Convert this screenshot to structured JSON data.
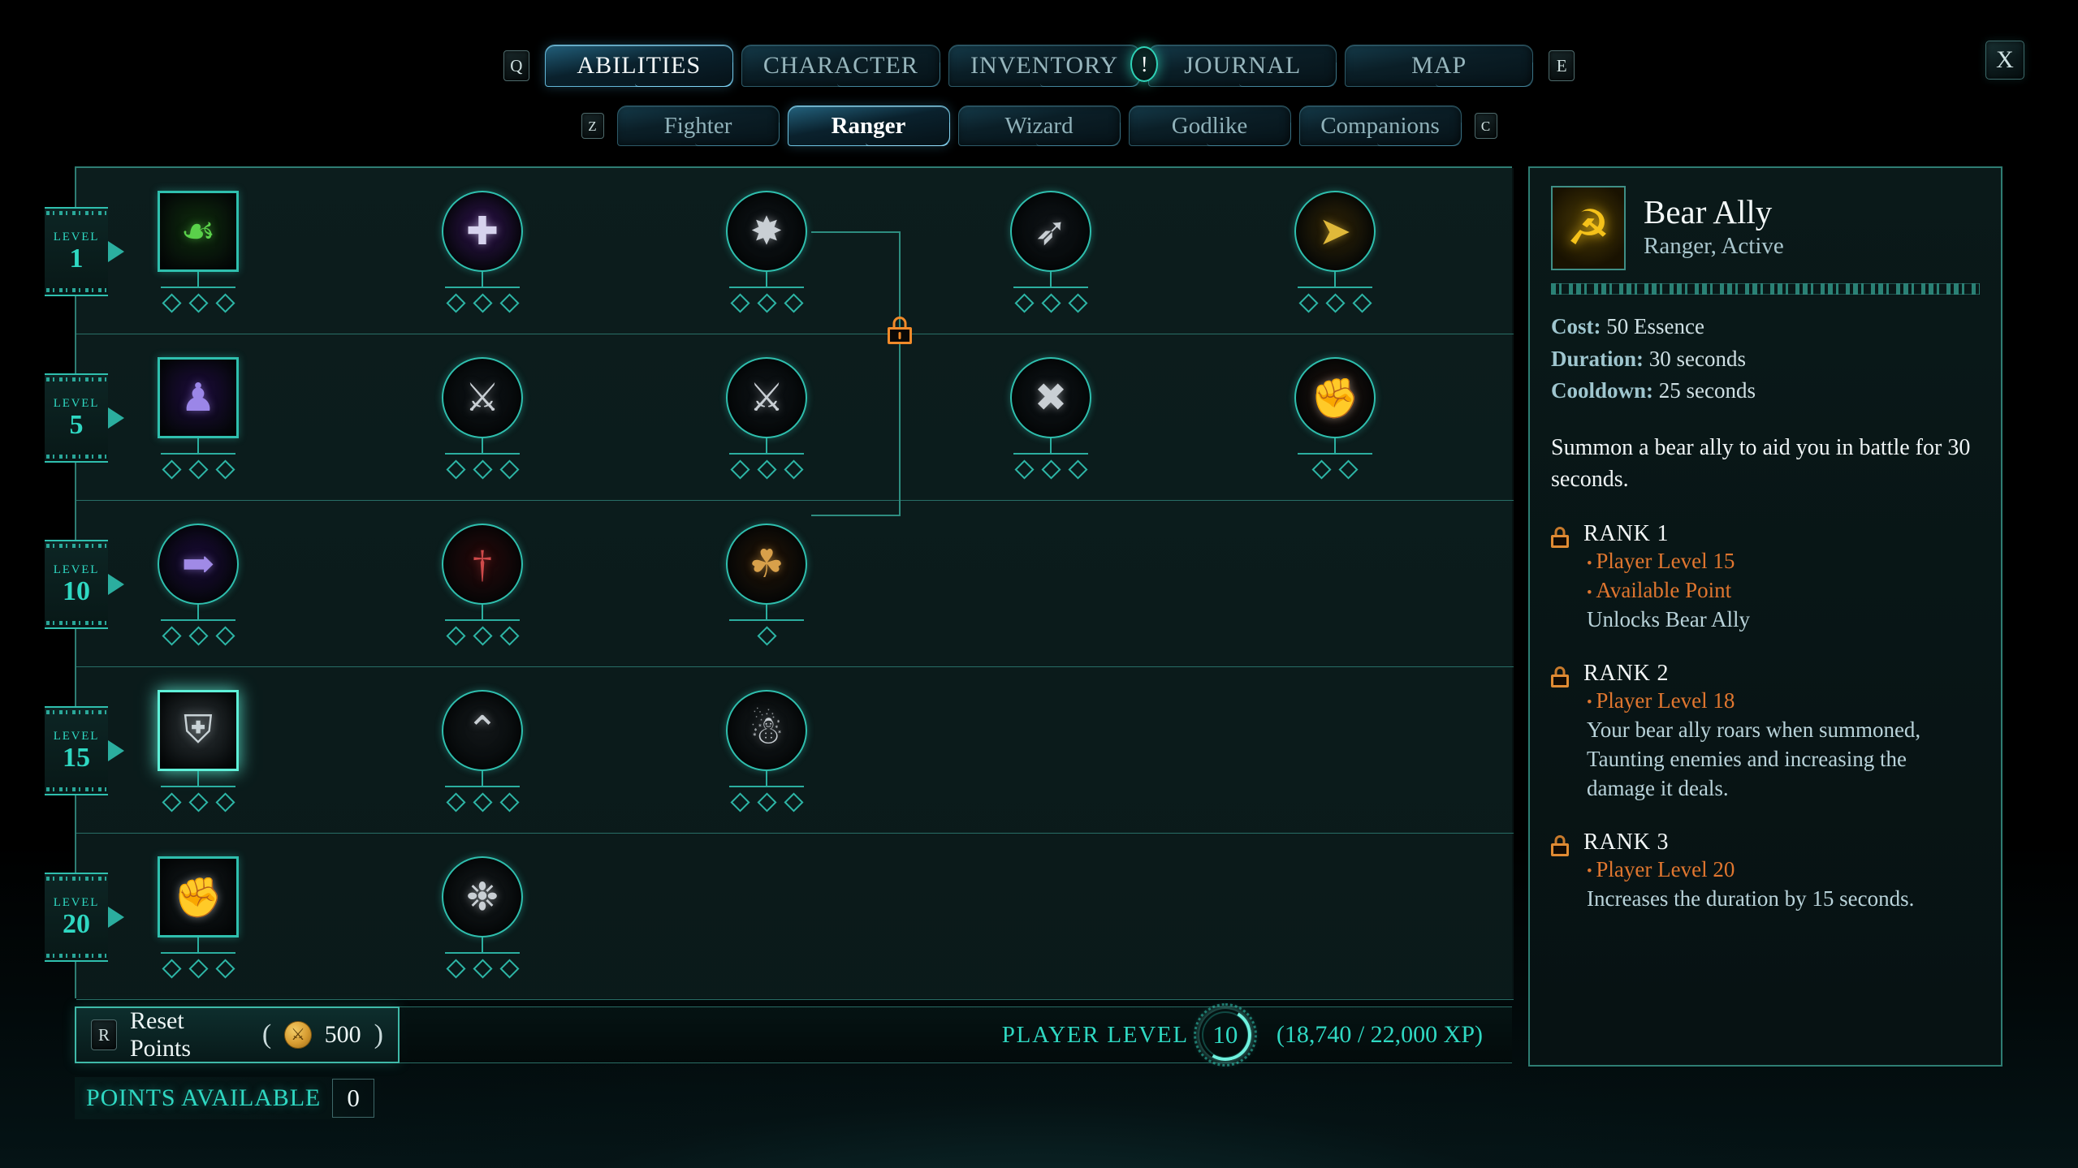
{
  "nav": {
    "left_key": "Q",
    "right_key": "E",
    "close_label": "X",
    "tabs": [
      {
        "label": "ABILITIES",
        "active": true,
        "badge": null
      },
      {
        "label": "CHARACTER",
        "active": false,
        "badge": null
      },
      {
        "label": "INVENTORY",
        "active": false,
        "badge": null
      },
      {
        "label": "JOURNAL",
        "active": false,
        "badge": "!"
      },
      {
        "label": "MAP",
        "active": false,
        "badge": null
      }
    ]
  },
  "subnav": {
    "left_key": "Z",
    "right_key": "C",
    "tabs": [
      {
        "label": "Fighter",
        "active": false
      },
      {
        "label": "Ranger",
        "active": true
      },
      {
        "label": "Wizard",
        "active": false
      },
      {
        "label": "Godlike",
        "active": false
      },
      {
        "label": "Companions",
        "active": false
      }
    ]
  },
  "tree": {
    "level_word": "LEVEL",
    "rows": [
      {
        "level": "1",
        "nodes": [
          {
            "name": "thorns-node",
            "shape": "square",
            "icon": "☙",
            "color": "#5ad14a",
            "bg": "#0e2a0c",
            "pips": 3,
            "locked": false,
            "selected": false
          },
          {
            "name": "potion-buff-node",
            "shape": "circle",
            "icon": "✚",
            "color": "#d7d3ee",
            "bg": "#2a1046",
            "pips": 3,
            "locked": false,
            "selected": false
          },
          {
            "name": "arrow-burst-node",
            "shape": "circle",
            "icon": "✸",
            "color": "#c9cfd4",
            "bg": "#0d1114",
            "pips": 3,
            "locked": false,
            "selected": false
          },
          {
            "name": "bow-shot-node",
            "shape": "circle",
            "icon": "➶",
            "color": "#c9cfd4",
            "bg": "#0d1114",
            "pips": 3,
            "locked": false,
            "selected": false
          },
          {
            "name": "volley-node",
            "shape": "circle",
            "icon": "➤",
            "color": "#e0b93a",
            "bg": "#2b2005",
            "pips": 3,
            "locked": false,
            "selected": false
          }
        ]
      },
      {
        "level": "5",
        "nodes": [
          {
            "name": "evasion-node",
            "shape": "square",
            "icon": "♟",
            "color": "#9b86e8",
            "bg": "#1c0b3a",
            "pips": 3,
            "locked": false,
            "selected": false
          },
          {
            "name": "piercing-shot-node",
            "shape": "circle",
            "icon": "⚔",
            "color": "#c9cfd4",
            "bg": "#0d1114",
            "pips": 3,
            "locked": false,
            "selected": false
          },
          {
            "name": "weapon-swap-node",
            "shape": "circle",
            "icon": "⚔",
            "color": "#c9cfd4",
            "bg": "#0d1114",
            "pips": 3,
            "locked": false,
            "selected": false
          },
          {
            "name": "crossed-blades-node",
            "shape": "circle",
            "icon": "✖",
            "color": "#c9cfd4",
            "bg": "#0d1114",
            "pips": 3,
            "locked": false,
            "selected": false
          },
          {
            "name": "hand-strike-node",
            "shape": "circle",
            "icon": "✊",
            "color": "#d8c4b2",
            "bg": "#1b0f0a",
            "pips": 2,
            "locked": false,
            "selected": false
          }
        ]
      },
      {
        "level": "10",
        "nodes": [
          {
            "name": "dash-node",
            "shape": "circle",
            "icon": "➡",
            "color": "#a08ae6",
            "bg": "#180a33",
            "pips": 3,
            "locked": false,
            "selected": false
          },
          {
            "name": "blood-arrow-node",
            "shape": "circle",
            "icon": "†",
            "color": "#cf4a4a",
            "bg": "#230708",
            "pips": 3,
            "locked": false,
            "selected": false
          },
          {
            "name": "bear-ally-node",
            "shape": "circle",
            "icon": "☘",
            "color": "#d8a04a",
            "bg": "#1e1105",
            "pips": 1,
            "locked": true,
            "selected": false
          }
        ]
      },
      {
        "level": "15",
        "nodes": [
          {
            "name": "shield-mastery-node",
            "shape": "square",
            "icon": "⛨",
            "color": "#c8d2d6",
            "bg": "#2b3134",
            "pips": 3,
            "locked": true,
            "selected": true
          },
          {
            "name": "chevron-rank-node",
            "shape": "circle",
            "icon": "⌃",
            "color": "#c9cfd4",
            "bg": "#121618",
            "pips": 3,
            "locked": true,
            "selected": false
          },
          {
            "name": "beast-call-node",
            "shape": "circle",
            "icon": "☃",
            "color": "#c9cfd4",
            "bg": "#121618",
            "pips": 3,
            "locked": true,
            "selected": false
          }
        ]
      },
      {
        "level": "20",
        "nodes": [
          {
            "name": "rapid-fist-node",
            "shape": "square",
            "icon": "✊",
            "color": "#c9cfd4",
            "bg": "#121618",
            "pips": 3,
            "locked": true,
            "selected": false
          },
          {
            "name": "whirlwind-node",
            "shape": "circle",
            "icon": "❉",
            "color": "#c9cfd4",
            "bg": "#121618",
            "pips": 3,
            "locked": true,
            "selected": false
          }
        ]
      }
    ]
  },
  "detail": {
    "title": "Bear Ally",
    "subtitle": "Ranger, Active",
    "icon": "bear-head-icon",
    "stats": [
      {
        "label": "Cost:",
        "value": "50 Essence"
      },
      {
        "label": "Duration:",
        "value": "30 seconds"
      },
      {
        "label": "Cooldown:",
        "value": "25 seconds"
      }
    ],
    "description": "Summon a bear ally to aid you in battle for 30 seconds.",
    "ranks": [
      {
        "title": "RANK 1",
        "locked": true,
        "requirements": [
          "Player Level 15",
          "Available Point"
        ],
        "effect": "Unlocks Bear Ally"
      },
      {
        "title": "RANK 2",
        "locked": true,
        "requirements": [
          "Player Level 18"
        ],
        "effect": "Your bear ally roars when summoned, Taunting enemies and increasing the damage it deals."
      },
      {
        "title": "RANK 3",
        "locked": true,
        "requirements": [
          "Player Level 20"
        ],
        "effect": "Increases the duration by 15 seconds."
      }
    ]
  },
  "footer": {
    "reset_key": "R",
    "reset_label": "Reset Points",
    "reset_cost": "500",
    "coin_icon": "gold-coin-icon",
    "player_level_label": "PLAYER LEVEL",
    "player_level": "10",
    "xp_text": "(18,740 / 22,000 XP)",
    "points_available_label": "POINTS AVAILABLE",
    "points_available": "0"
  }
}
